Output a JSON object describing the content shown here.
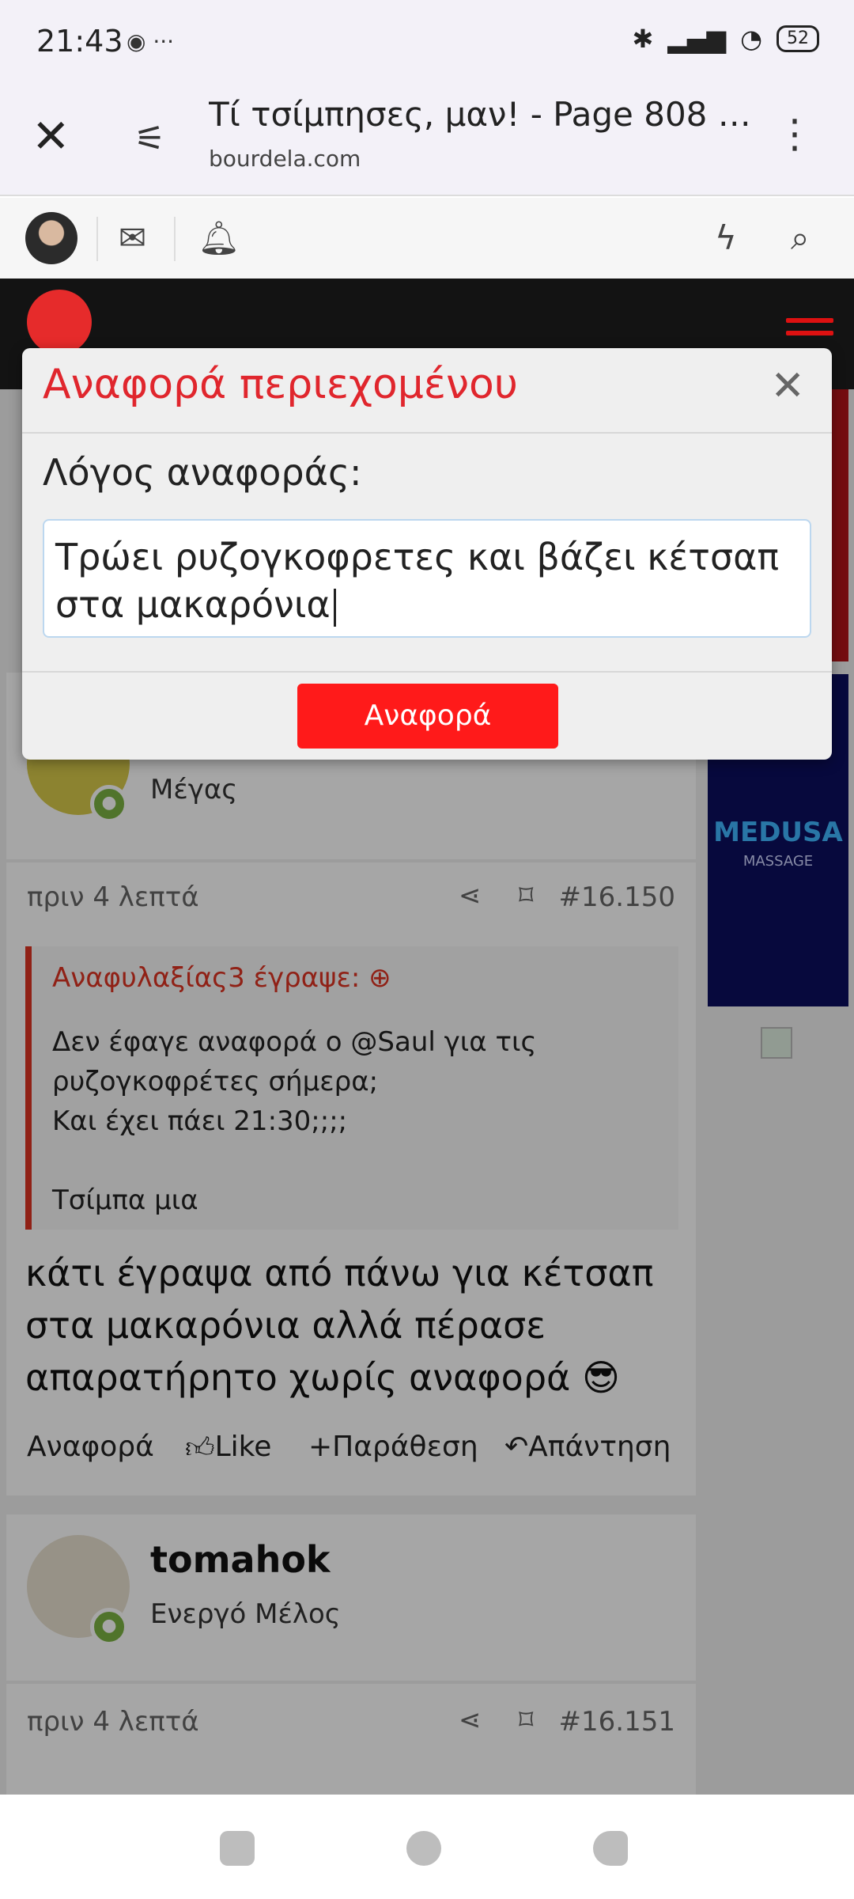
{
  "status_bar": {
    "time": "21:43",
    "left_icons": "◉ ···",
    "battery": "52"
  },
  "browser": {
    "title": "Τί τσίμπησες, μαν! - Page 808 - b...",
    "domain": "bourdela.com"
  },
  "modal": {
    "title": "Αναφορά περιεχομένου",
    "label": "Λόγος αναφοράς:",
    "textarea_value": "Τρώει ρυζογκοφρετες και βάζει κέτσαπ στα μακαρόνια",
    "submit_label": "Αναφορά"
  },
  "post_1": {
    "user_role": "Μέγας",
    "date": "πριν 4 λεπτά",
    "post_number": "#16.150",
    "quote_header": "Αναφυλαξίας3 έγραψε:",
    "quote_lines": [
      "Δεν έφαγε αναφορά ο @Saul για τις",
      "ρυζογκοφρέτες σήμερα;",
      "Και έχει πάει 21:30;;;;",
      "Τσίμπα μια"
    ],
    "text": "κάτι έγραψα από πάνω για κέτσαπ στα μακαρόνια αλλά πέρασε απαρατήρητο χωρίς αναφορά 😎",
    "actions": {
      "report": "Αναφορά",
      "like": "Like",
      "quote": "Παράθεση",
      "reply": "Απάντηση"
    }
  },
  "post_2": {
    "username": "tomahok",
    "user_role": "Ενεργό Μέλος",
    "date": "πριν 4 λεπτά",
    "post_number": "#16.151"
  },
  "sidebar": {
    "ad_text": "MEDUSA",
    "ad_subtext": "MASSAGE"
  },
  "colors": {
    "accent_red": "#e0262d",
    "button_red": "#ff1a1a",
    "header_dark": "#131313",
    "online_green": "#7cb342"
  }
}
